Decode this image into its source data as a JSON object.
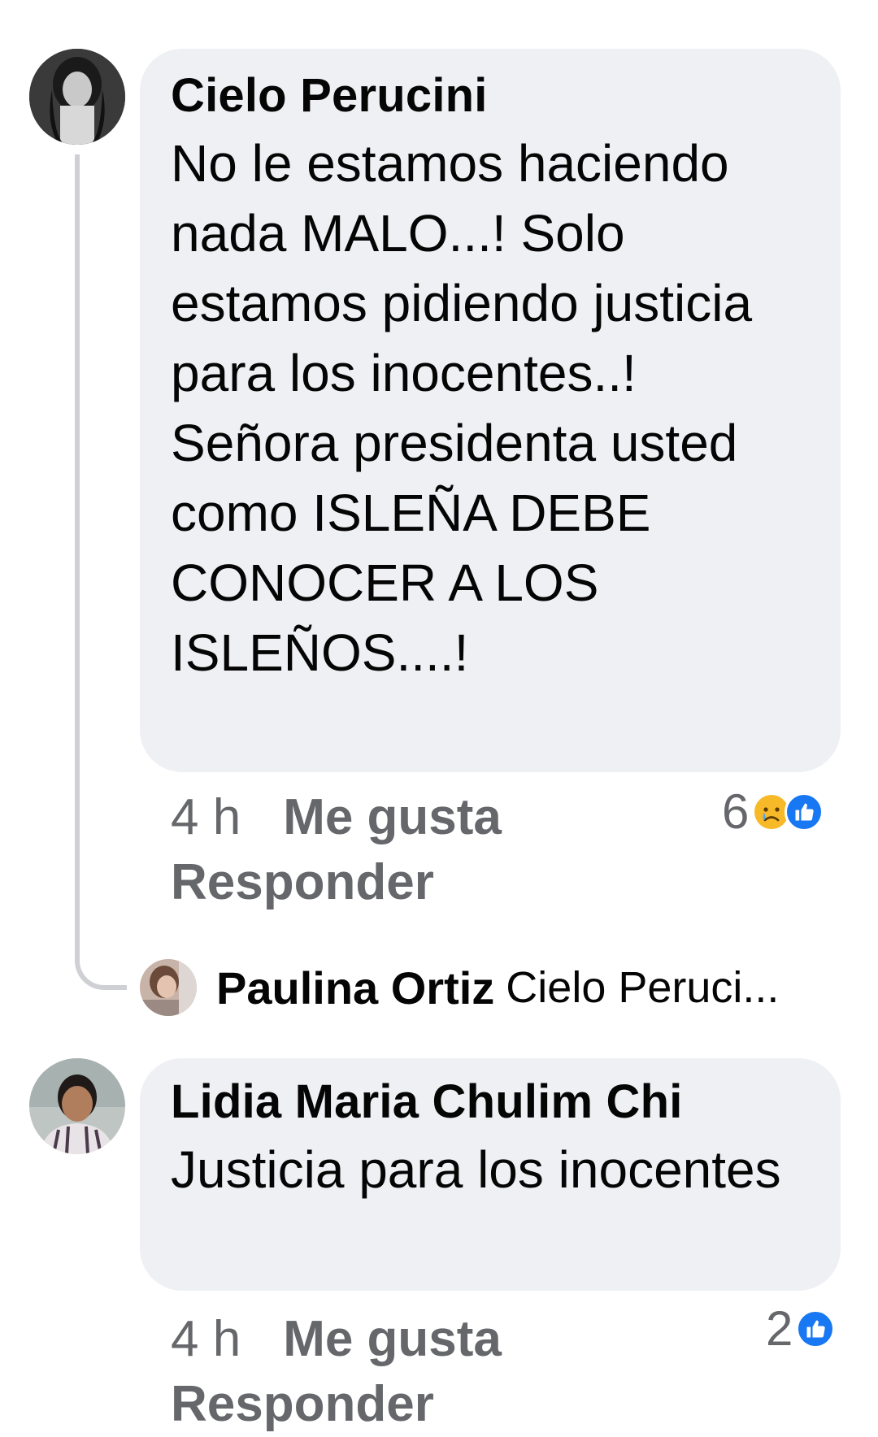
{
  "comments": [
    {
      "author": "Cielo Perucini",
      "text": "No le estamos haciendo nada MALO...! Solo estamos pidiendo justicia para los inocentes..!\nSeñora presidenta usted como ISLEÑA DEBE CONOCER A LOS ISLEÑOS....!",
      "time": "4 h",
      "like_label": "Me gusta",
      "reply_label": "Responder",
      "reaction_count": "6",
      "reactions": [
        "sad-icon",
        "like-icon"
      ]
    },
    {
      "author": "Lidia Maria Chulim Chi",
      "text": "Justicia para los inocentes",
      "time": "4 h",
      "like_label": "Me gusta",
      "reply_label": "Responder",
      "reaction_count": "2",
      "reactions": [
        "like-icon"
      ]
    }
  ],
  "reply_preview": {
    "author": "Paulina Ortiz",
    "snippet": "Cielo Peruci..."
  },
  "colors": {
    "bubble": "#eff0f4",
    "meta_text": "#65676b",
    "like_blue": "#1877f2",
    "sad_yellow": "#f7b928"
  }
}
